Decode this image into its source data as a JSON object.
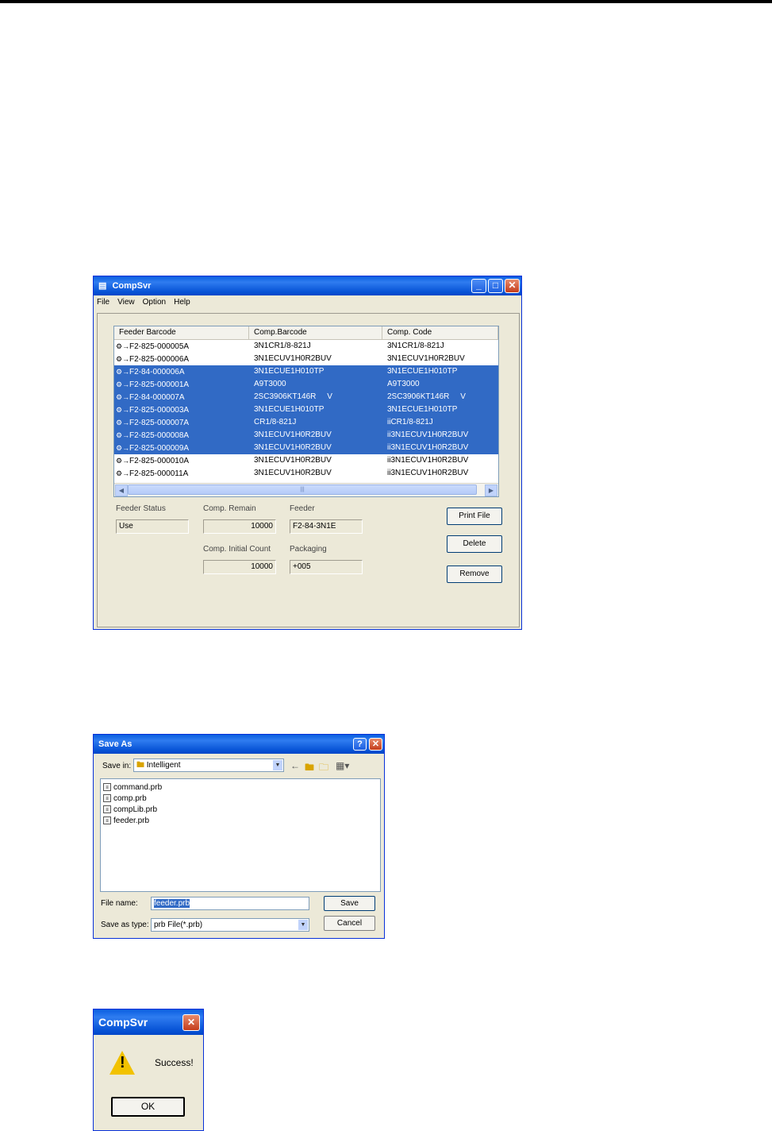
{
  "compsvr": {
    "title": "CompSvr",
    "menu": [
      "File",
      "View",
      "Option",
      "Help"
    ],
    "columns": [
      "Feeder Barcode",
      "Comp.Barcode",
      "Comp. Code"
    ],
    "rows": [
      {
        "feeder": "F2-825-000005A",
        "barcode": "3N1CR1/8-821J",
        "code": "3N1CR1/8-821J",
        "selected": false
      },
      {
        "feeder": "F2-825-000006A",
        "barcode": "3N1ECUV1H0R2BUV",
        "code": "3N1ECUV1H0R2BUV",
        "selected": false
      },
      {
        "feeder": "F2-84-000006A",
        "barcode": "3N1ECUE1H010TP",
        "code": "3N1ECUE1H010TP",
        "selected": true
      },
      {
        "feeder": "F2-825-000001A",
        "barcode": "A9T3000",
        "code": "A9T3000",
        "selected": true
      },
      {
        "feeder": "F2-84-000007A",
        "barcode": "2SC3906KT146R     V",
        "code": "2SC3906KT146R     V",
        "selected": true
      },
      {
        "feeder": "F2-825-000003A",
        "barcode": "3N1ECUE1H010TP",
        "code": "3N1ECUE1H010TP",
        "selected": true
      },
      {
        "feeder": "F2-825-000007A",
        "barcode": "CR1/8-821J",
        "code": "iiCR1/8-821J",
        "selected": true
      },
      {
        "feeder": "F2-825-000008A",
        "barcode": "3N1ECUV1H0R2BUV",
        "code": "ii3N1ECUV1H0R2BUV",
        "selected": true
      },
      {
        "feeder": "F2-825-000009A",
        "barcode": "3N1ECUV1H0R2BUV",
        "code": "ii3N1ECUV1H0R2BUV",
        "selected": true
      },
      {
        "feeder": "F2-825-000010A",
        "barcode": "3N1ECUV1H0R2BUV",
        "code": "ii3N1ECUV1H0R2BUV",
        "selected": false
      },
      {
        "feeder": "F2-825-000011A",
        "barcode": "3N1ECUV1H0R2BUV",
        "code": "ii3N1ECUV1H0R2BUV",
        "selected": false
      }
    ],
    "labels": {
      "feeder_status": "Feeder Status",
      "comp_remain": "Comp. Remain",
      "feeder": "Feeder",
      "comp_initial": "Comp. Initial Count",
      "packaging": "Packaging"
    },
    "values": {
      "feeder_status": "Use",
      "comp_remain": "10000",
      "feeder": "F2-84-3N1E",
      "comp_initial": "10000",
      "packaging": "+005"
    },
    "buttons": {
      "print": "Print File",
      "delete": "Delete",
      "remove": "Remove"
    }
  },
  "saveas": {
    "title": "Save As",
    "save_in_label": "Save in:",
    "save_in_value": "Intelligent",
    "files": [
      "command.prb",
      "comp.prb",
      "compLib.prb",
      "feeder.prb"
    ],
    "file_name_label": "File name:",
    "file_name_value": "feeder.prb",
    "save_type_label": "Save as type:",
    "save_type_value": "prb File(*.prb)",
    "save_button": "Save",
    "cancel_button": "Cancel"
  },
  "msgbox": {
    "title": "CompSvr",
    "message": "Success!",
    "ok_button": "OK"
  }
}
